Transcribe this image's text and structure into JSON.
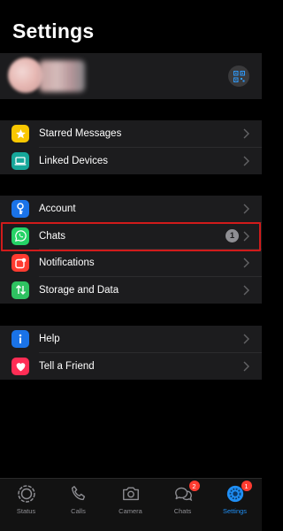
{
  "header": {
    "title": "Settings"
  },
  "profile": {
    "qr_icon": "qr-code-icon"
  },
  "group1": [
    {
      "label": "Starred Messages",
      "icon": "star-icon",
      "color": "#f9c700"
    },
    {
      "label": "Linked Devices",
      "icon": "laptop-icon",
      "color": "#16a79a"
    }
  ],
  "group2": [
    {
      "label": "Account",
      "icon": "key-icon",
      "color": "#1a73e8"
    },
    {
      "label": "Chats",
      "icon": "whatsapp-icon",
      "color": "#25d366",
      "badge": "1"
    },
    {
      "label": "Notifications",
      "icon": "notification-icon",
      "color": "#ff3b30"
    },
    {
      "label": "Storage and Data",
      "icon": "arrows-updown-icon",
      "color": "#2fc261"
    }
  ],
  "group3": [
    {
      "label": "Help",
      "icon": "info-icon",
      "color": "#1a73e8"
    },
    {
      "label": "Tell a Friend",
      "icon": "heart-icon",
      "color": "#ff2d55"
    }
  ],
  "tabbar": [
    {
      "label": "Status",
      "icon": "status-icon"
    },
    {
      "label": "Calls",
      "icon": "phone-icon"
    },
    {
      "label": "Camera",
      "icon": "camera-icon"
    },
    {
      "label": "Chats",
      "icon": "chat-bubbles-icon",
      "badge": "2"
    },
    {
      "label": "Settings",
      "icon": "settings-gear-icon",
      "badge": "1",
      "active": true
    }
  ],
  "colors": {
    "highlight": "#d11b1b",
    "accent": "#1f8ff5",
    "badge_red": "#ff3b30"
  }
}
